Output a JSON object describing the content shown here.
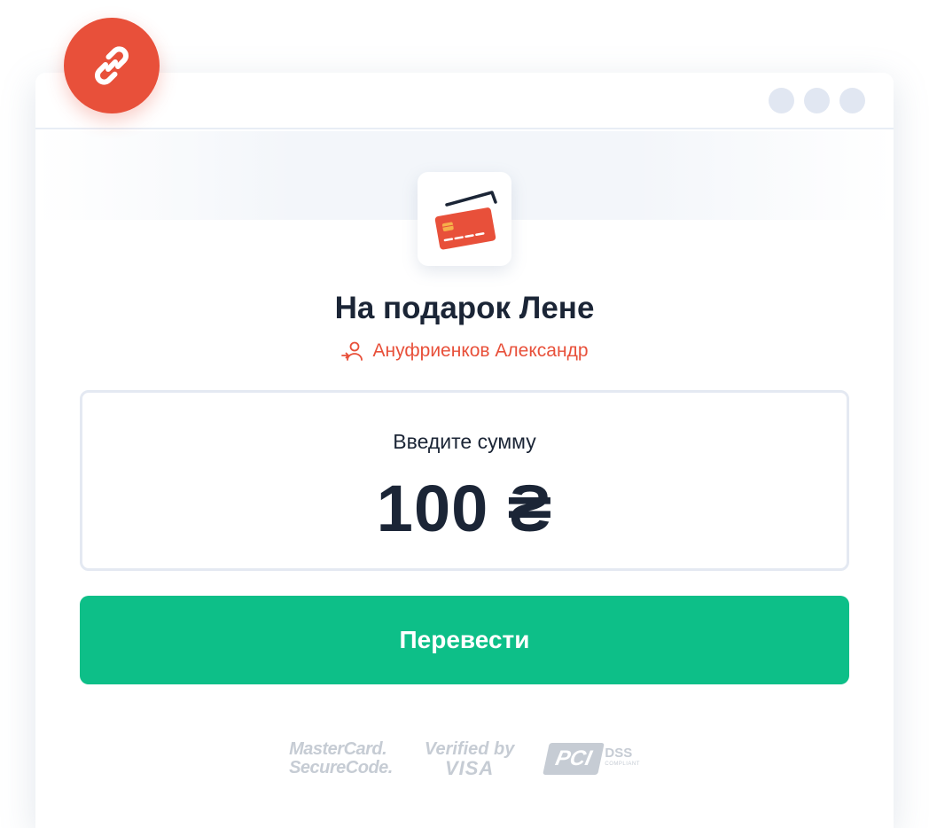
{
  "window": {
    "controls": [
      "dot",
      "dot",
      "dot"
    ]
  },
  "badge": {
    "icon": "link-icon",
    "color": "#e8503a"
  },
  "card": {
    "icon": "credit-card-icon"
  },
  "title": "На подарок Лене",
  "owner": {
    "icon": "user-icon",
    "name": "Ануфриенков Александр"
  },
  "amount": {
    "label": "Введите сумму",
    "value": "100 ₴"
  },
  "button": {
    "label": "Перевести",
    "color": "#0dbf88"
  },
  "logos": {
    "mastercard_line1": "MasterCard.",
    "mastercard_line2": "SecureCode.",
    "visa_line1": "Verified by",
    "visa_line2": "VISA",
    "pci_mark": "PCI",
    "pci_line1": "DSS",
    "pci_line2": "COMPLIANT"
  }
}
